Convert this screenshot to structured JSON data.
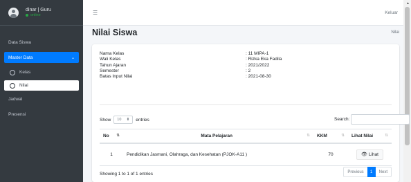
{
  "user": {
    "name": "dinar | Guru",
    "status": "online"
  },
  "sidebar": {
    "items": [
      {
        "label": "Data Siswa"
      },
      {
        "label": "Master Data"
      },
      {
        "label": "Kelas"
      },
      {
        "label": "Nilai"
      },
      {
        "label": "Jadwal"
      },
      {
        "label": "Presensi"
      }
    ]
  },
  "topbar": {
    "logout": "Keluar"
  },
  "page": {
    "title": "Nilai Siswa",
    "breadcrumb": "Nilai"
  },
  "info": [
    {
      "label": "Nama Kelas",
      "value": ": 11 MIPA-1"
    },
    {
      "label": "Wali Kelas",
      "value": ": Rizka Eka Fadila"
    },
    {
      "label": "Tahun Ajaran",
      "value": ": 2021/2022"
    },
    {
      "label": "Semester",
      "value": ": 2"
    },
    {
      "label": "Batas Input Nilai",
      "value": ": 2021-08-30"
    }
  ],
  "table_controls": {
    "show_label": "Show",
    "entries_value": "10",
    "entries_label": "entries",
    "search_label": "Search:"
  },
  "table": {
    "headers": [
      "No",
      "Mata Pelajaran",
      "KKM",
      "Lihat Nilai"
    ],
    "rows": [
      {
        "no": "1",
        "mapel": "Pendidikan Jasmani, Olahraga, dan Kesehatan (PJOK-A11 )",
        "kkm": "70",
        "action": "Lihat"
      }
    ]
  },
  "footer": {
    "info": "Showing 1 to 1 of 1 entries",
    "previous": "Previous",
    "page": "1",
    "next": "Next"
  }
}
